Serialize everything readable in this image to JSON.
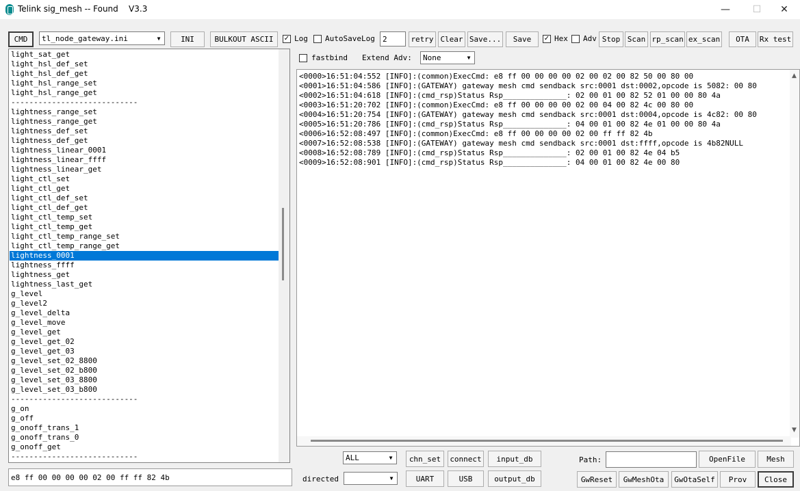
{
  "window": {
    "title": "Telink sig_mesh -- Found    V3.3",
    "minimize_glyph": "—",
    "maximize_glyph": "☐",
    "close_glyph": "✕"
  },
  "toolbar": {
    "cmd_label": "CMD",
    "ini_file": "tl_node_gateway.ini",
    "ini_label": "INI",
    "bulkout_label": "BULKOUT ASCII",
    "log_label": "Log",
    "log_checked": true,
    "autosave_label": "AutoSaveLog",
    "autosave_checked": false,
    "retry_value": "2",
    "retry_label": "retry",
    "clear_label": "Clear",
    "save_dots_label": "Save...",
    "save_label": "Save",
    "hex_label": "Hex",
    "hex_checked": true,
    "adv_label": "Adv",
    "adv_checked": false,
    "stop_label": "Stop",
    "scan_label": "Scan",
    "rp_scan_label": "rp_scan",
    "ex_scan_label": "ex_scan",
    "ota_label": "OTA",
    "rx_test_label": "Rx test"
  },
  "options": {
    "fastbind_label": "fastbind",
    "fastbind_checked": false,
    "extend_adv_label": "Extend Adv:",
    "extend_adv_value": "None"
  },
  "command_list": {
    "selected_index": 21,
    "items": [
      "light_sat_get",
      "light_hsl_def_set",
      "light_hsl_def_get",
      "light_hsl_range_set",
      "light_hsl_range_get",
      "----------------------------",
      "lightness_range_set",
      "lightness_range_get",
      "lightness_def_set",
      "lightness_def_get",
      "lightness_linear_0001",
      "lightness_linear_ffff",
      "lightness_linear_get",
      "light_ctl_set",
      "light_ctl_get",
      "light_ctl_def_set",
      "light_ctl_def_get",
      "light_ctl_temp_set",
      "light_ctl_temp_get",
      "light_ctl_temp_range_set",
      "light_ctl_temp_range_get",
      "lightness_0001",
      "lightness_ffff",
      "lightness_get",
      "lightness_last_get",
      "g_level",
      "g_level2",
      "g_level_delta",
      "g_level_move",
      "g_level_get",
      "g_level_get_02",
      "g_level_get_03",
      "g_level_set_02_8800",
      "g_level_set_02_b800",
      "g_level_set_03_8800",
      "g_level_set_03_b800",
      "----------------------------",
      "g_on",
      "g_off",
      "g_onoff_trans_1",
      "g_onoff_trans_0",
      "g_onoff_get",
      "----------------------------"
    ]
  },
  "command_input": "e8 ff 00 00 00 00 02 00 ff ff 82 4b",
  "log": {
    "lines": [
      "<0000>16:51:04:552 [INFO]:(common)ExecCmd: e8 ff 00 00 00 00 02 00 02 00 82 50 00 80 00",
      "<0001>16:51:04:586 [INFO]:(GATEWAY) gateway mesh cmd sendback src:0001 dst:0002,opcode is 5082: 00 80",
      "<0002>16:51:04:618 [INFO]:(cmd_rsp)Status Rsp______________: 02 00 01 00 82 52 01 00 00 80 4a",
      "<0003>16:51:20:702 [INFO]:(common)ExecCmd: e8 ff 00 00 00 00 02 00 04 00 82 4c 00 80 00",
      "<0004>16:51:20:754 [INFO]:(GATEWAY) gateway mesh cmd sendback src:0001 dst:0004,opcode is 4c82: 00 80",
      "<0005>16:51:20:786 [INFO]:(cmd_rsp)Status Rsp______________: 04 00 01 00 82 4e 01 00 00 80 4a",
      "<0006>16:52:08:497 [INFO]:(common)ExecCmd: e8 ff 00 00 00 00 02 00 ff ff 82 4b",
      "<0007>16:52:08:538 [INFO]:(GATEWAY) gateway mesh cmd sendback src:0001 dst:ffff,opcode is 4b82NULL",
      "<0008>16:52:08:789 [INFO]:(cmd_rsp)Status Rsp______________: 02 00 01 00 82 4e 04 b5",
      "<0009>16:52:08:901 [INFO]:(cmd_rsp)Status Rsp______________: 04 00 01 00 82 4e 00 80"
    ]
  },
  "bottom": {
    "filter_value": "ALL",
    "directed_label": "directed",
    "directed_value": "",
    "chn_set_label": "chn_set",
    "connect_label": "connect",
    "input_db_label": "input_db",
    "uart_label": "UART",
    "usb_label": "USB",
    "output_db_label": "output_db",
    "path_label": "Path:",
    "path_value": "",
    "openfile_label": "OpenFile",
    "mesh_label": "Mesh",
    "gwreset_label": "GwReset",
    "gwmeshota_label": "GwMeshOta",
    "gwotaself_label": "GwOtaSelf",
    "prov_label": "Prov",
    "close_label": "Close"
  },
  "icons": {
    "app": "bluetooth-icon",
    "dropdown": "chevron-down-icon",
    "check_mark": "✓",
    "dropdown_glyph": "▼",
    "scroll_up_glyph": "▲",
    "scroll_down_glyph": "▼"
  }
}
